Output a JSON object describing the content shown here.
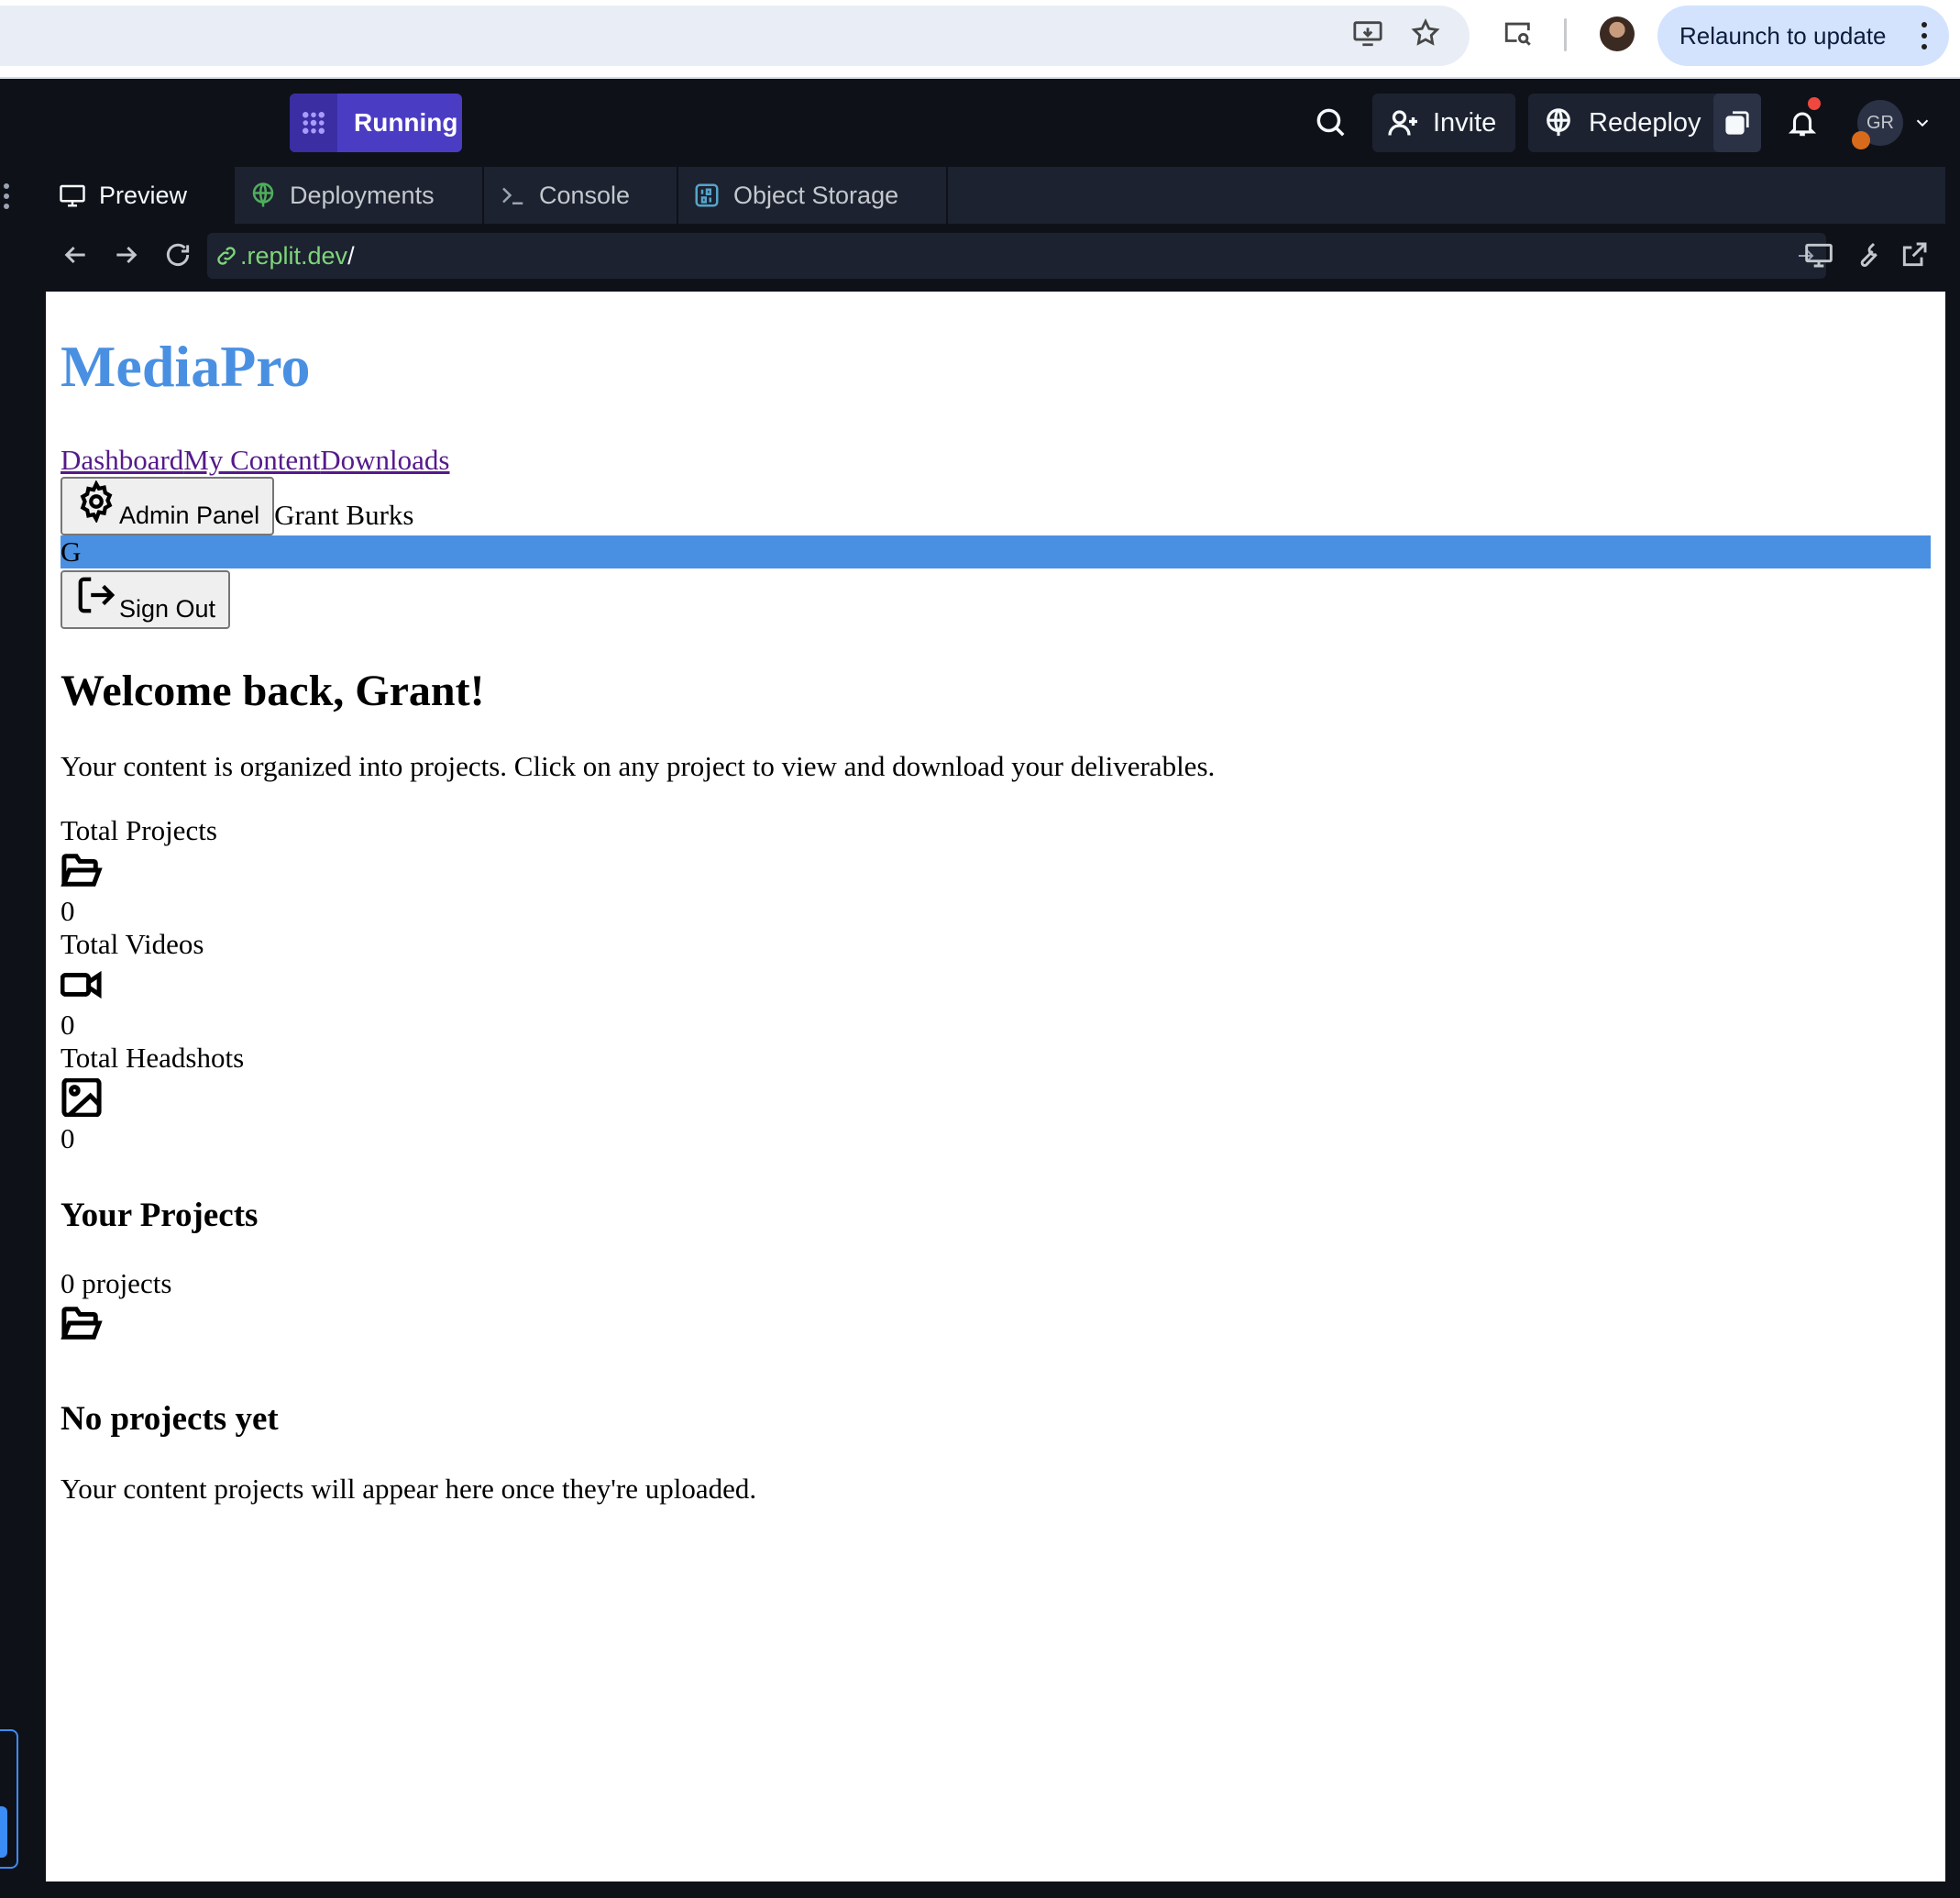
{
  "chrome": {
    "relaunch_label": "Relaunch to update",
    "icons": [
      "install-app-icon",
      "bookmark-star-icon",
      "media-search-icon",
      "profile-avatar",
      "more-vert-icon"
    ]
  },
  "replit": {
    "run_status": "Running",
    "invite_label": "Invite",
    "redeploy_label": "Redeploy",
    "user_initials": "GR",
    "tabs": [
      {
        "label": "Preview",
        "icon": "monitor-icon",
        "active": true
      },
      {
        "label": "Deployments",
        "icon": "globe-icon",
        "active": false
      },
      {
        "label": "Console",
        "icon": "terminal-icon",
        "active": false
      },
      {
        "label": "Object Storage",
        "icon": "storage-icon",
        "active": false
      }
    ],
    "url": {
      "host": ".replit.dev",
      "path": "/"
    },
    "colors": {
      "run_purple": "#4b3cc4",
      "dark_bg": "#0e1118",
      "panel_bg": "#1c2230",
      "url_green": "#7fd47a"
    }
  },
  "app": {
    "brand": "MediaPro",
    "nav": [
      "Dashboard",
      "My Content",
      "Downloads"
    ],
    "admin_button": "Admin Panel",
    "user_name": "Grant Burks",
    "avatar_letter": "G",
    "signout_button": "Sign Out",
    "welcome": "Welcome back, Grant!",
    "intro": "Your content is organized into projects. Click on any project to view and download your deliverables.",
    "stats": [
      {
        "label": "Total Projects",
        "icon": "folder-open-icon",
        "value": "0"
      },
      {
        "label": "Total Videos",
        "icon": "video-icon",
        "value": "0"
      },
      {
        "label": "Total Headshots",
        "icon": "image-icon",
        "value": "0"
      }
    ],
    "projects_title": "Your Projects",
    "projects_count": "0 projects",
    "empty_title": "No projects yet",
    "empty_text": "Your content projects will appear here once they're uploaded.",
    "colors": {
      "brand_blue": "#4a90e2",
      "link_visited": "#551a8b"
    }
  }
}
